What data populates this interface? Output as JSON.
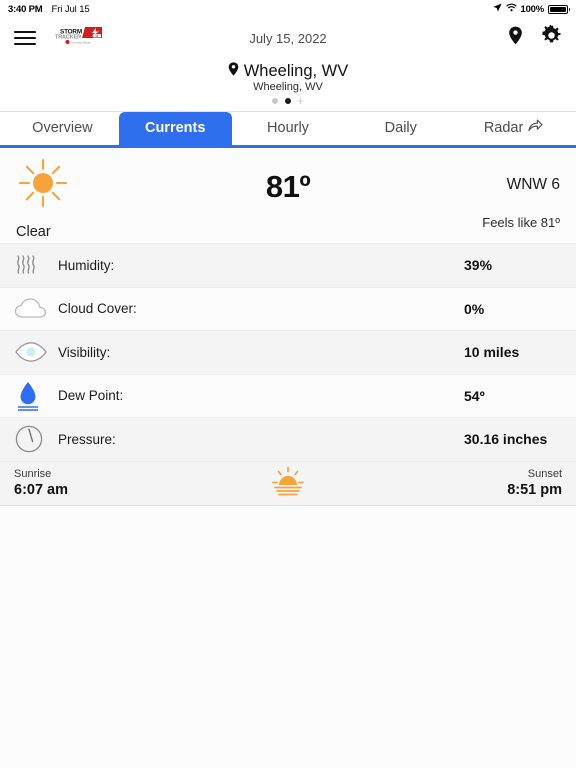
{
  "status_bar": {
    "time": "3:40 PM",
    "date": "Fri Jul 15",
    "battery_percent": "100%",
    "location_icon": "location-arrow-icon",
    "wifi_icon": "wifi-icon",
    "battery_icon": "battery-full-icon"
  },
  "navbar": {
    "menu_icon": "hamburger-menu-icon",
    "logo": {
      "name": "storm-tracker-logo",
      "word_top": "STORM",
      "word_bottom": "TRACKER",
      "badge": "13",
      "tagline": "Courtesy Bank"
    },
    "date": "July 15, 2022",
    "pin_icon": "location-pin-icon",
    "settings_icon": "gear-icon"
  },
  "location": {
    "pin_icon": "location-pin-icon",
    "title": "Wheeling, WV",
    "subtitle": "Wheeling, WV",
    "pager": {
      "dots": 2,
      "active_index": 1,
      "add_label": "+"
    }
  },
  "tabs": {
    "active": "Currents",
    "items": [
      {
        "label": "Overview",
        "icon": null
      },
      {
        "label": "Currents",
        "icon": null
      },
      {
        "label": "Hourly",
        "icon": null
      },
      {
        "label": "Daily",
        "icon": null
      },
      {
        "label": "Radar",
        "icon": "share-arrow-icon"
      }
    ]
  },
  "current": {
    "icon": "sun-icon",
    "condition": "Clear",
    "temperature": "81º",
    "wind": "WNW 6",
    "feels_like": "Feels like 81º"
  },
  "details": [
    {
      "icon": "humidity-waves-icon",
      "label": "Humidity:",
      "value": "39%"
    },
    {
      "icon": "cloud-icon",
      "label": "Cloud Cover:",
      "value": "0%"
    },
    {
      "icon": "eye-visibility-icon",
      "label": "Visibility:",
      "value": "10 miles"
    },
    {
      "icon": "water-drop-icon",
      "label": "Dew Point:",
      "value": "54º"
    },
    {
      "icon": "pressure-gauge-icon",
      "label": "Pressure:",
      "value": "30.16 inches"
    }
  ],
  "sun": {
    "sunrise_label": "Sunrise",
    "sunrise_value": "6:07 am",
    "icon": "sunrise-icon",
    "sunset_label": "Sunset",
    "sunset_value": "8:51 pm"
  },
  "colors": {
    "accent_blue": "#2f6fed",
    "sun_orange": "#f7a33c",
    "drop_blue": "#2f6fed",
    "logo_red": "#cc1f22"
  }
}
